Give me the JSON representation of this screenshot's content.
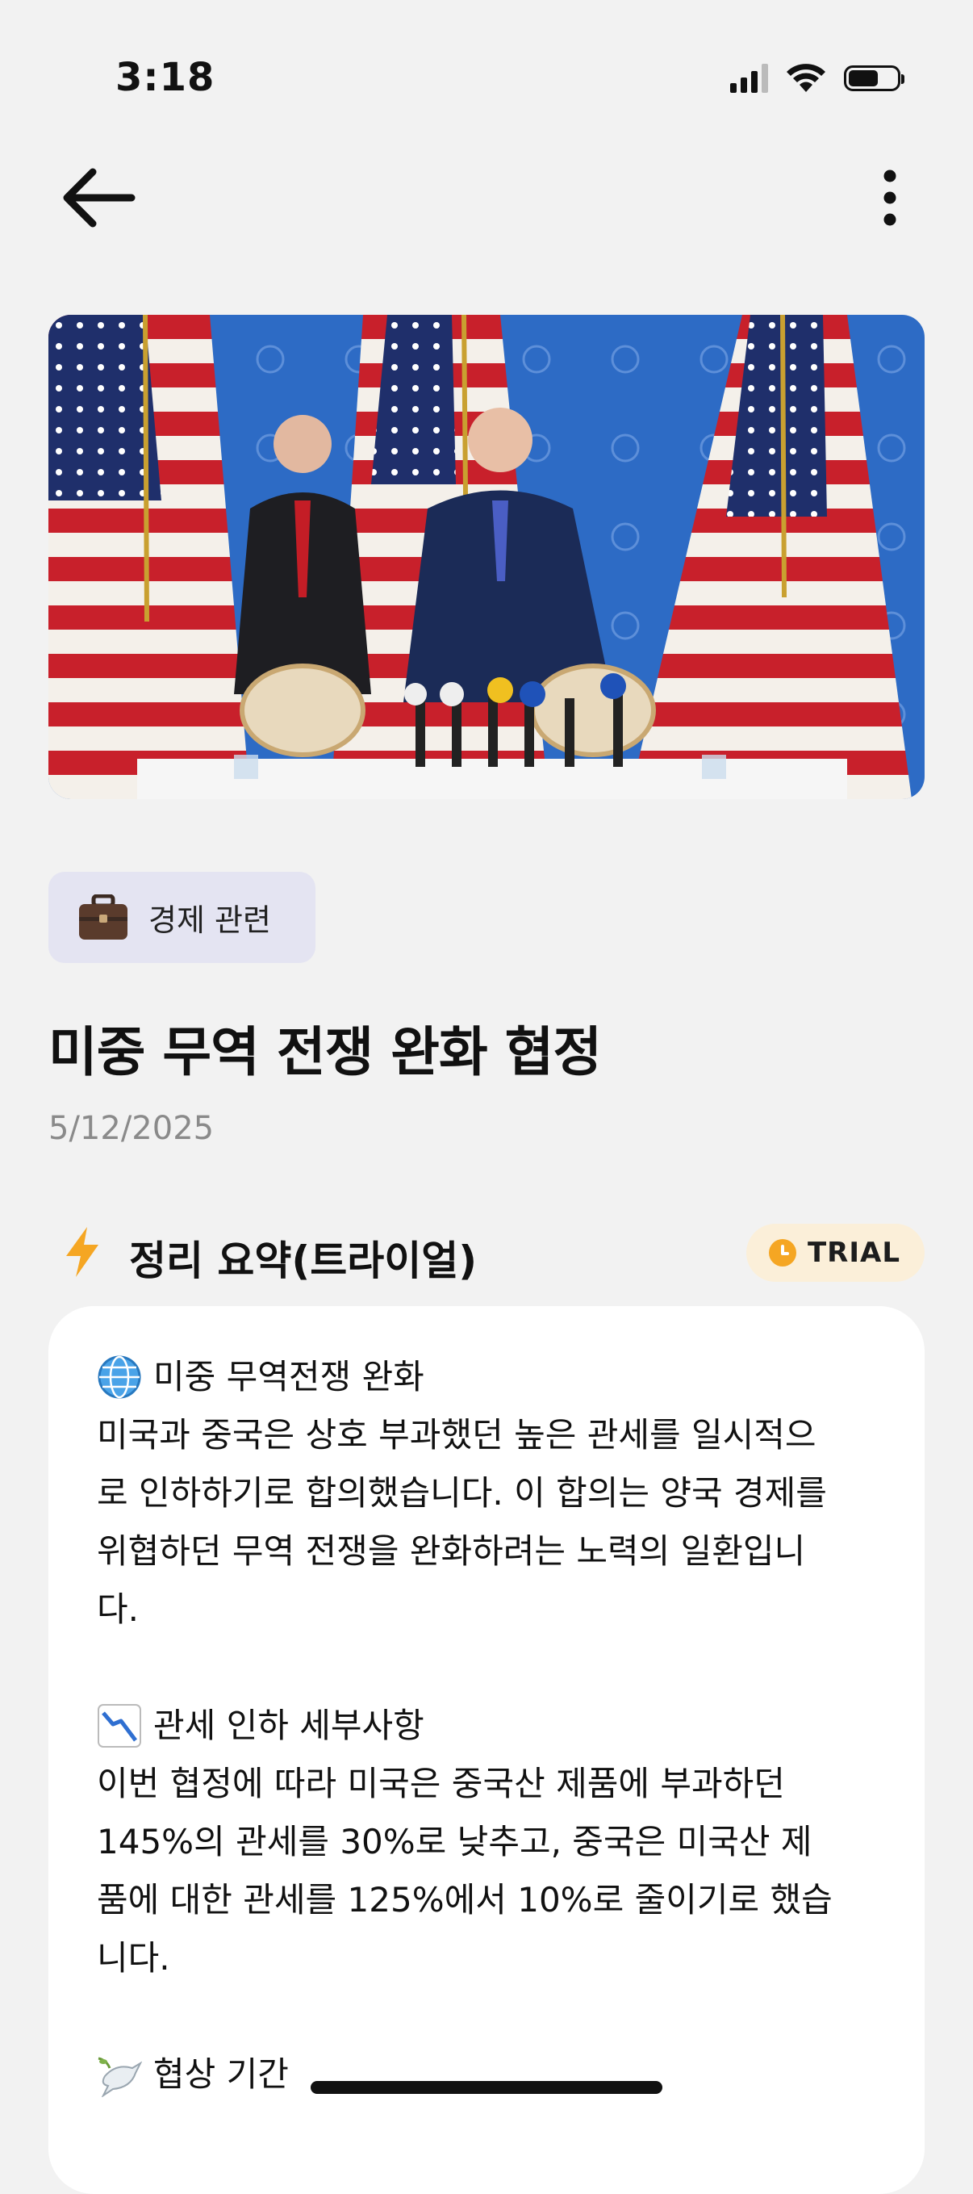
{
  "status_bar": {
    "time": "3:18"
  },
  "nav": {
    "back_icon": "arrow-left-icon",
    "more_icon": "more-vertical-icon"
  },
  "hero": {
    "image_subject": "press-conference-photo"
  },
  "category": {
    "icon": "briefcase-icon",
    "label": "경제 관련"
  },
  "article": {
    "title": "미중 무역 전쟁 완화 협정",
    "date": "5/12/2025"
  },
  "summary": {
    "icon": "lightning-icon",
    "title": "정리 요약(트라이얼)",
    "badge_icon": "clock-icon",
    "badge_label": "TRIAL",
    "sections": [
      {
        "icon": "globe-icon",
        "heading": "미중 무역전쟁 완화",
        "body": "미국과 중국은 상호 부과했던 높은 관세를 일시적으\n로 인하하기로 합의했습니다. 이 합의는 양국 경제를\n위협하던 무역 전쟁을 완화하려는 노력의 일환입니\n다."
      },
      {
        "icon": "chart-decreasing-icon",
        "heading": "관세 인하 세부사항",
        "body": "이번 협정에 따라 미국은 중국산 제품에 부과하던\n145%의 관세를 30%로 낮추고, 중국은 미국산 제\n품에 대한 관세를 125%에서 10%로 줄이기로 했습\n니다."
      },
      {
        "icon": "dove-icon",
        "heading": "협상 기간",
        "body": ""
      }
    ]
  },
  "colors": {
    "background": "#f2f2f2",
    "chip_background": "#e4e4f2",
    "trial_badge_background": "#fbefd9",
    "accent_orange": "#f5a623",
    "date_gray": "#8a8a8a"
  }
}
